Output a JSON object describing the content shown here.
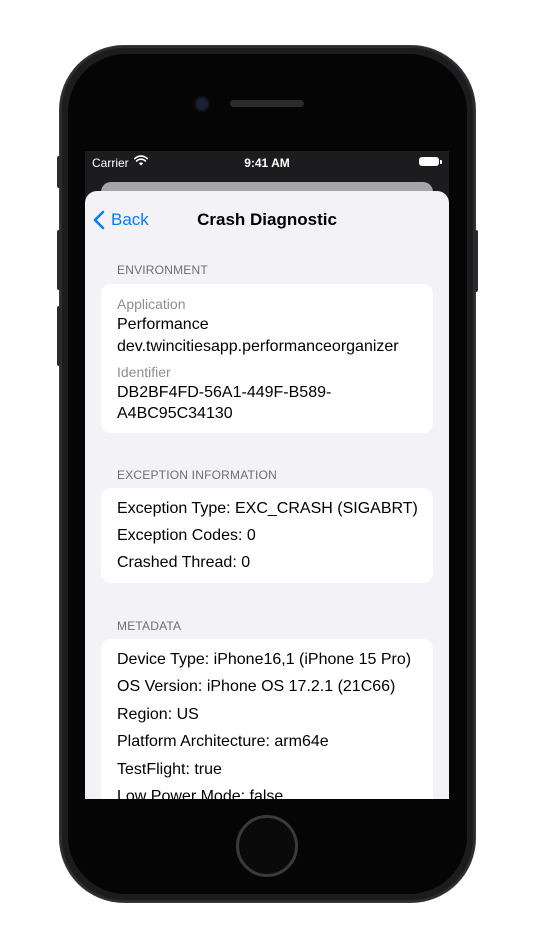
{
  "status_bar": {
    "carrier": "Carrier",
    "time": "9:41 AM"
  },
  "nav": {
    "back_label": "Back",
    "title": "Crash Diagnostic"
  },
  "environment": {
    "header": "ENVIRONMENT",
    "application_label": "Application",
    "application_name": "Performance",
    "application_bundle": "dev.twincitiesapp.performanceorganizer",
    "identifier_label": "Identifier",
    "identifier_line1": "DB2BF4FD-56A1-449F-B589-",
    "identifier_line2": "A4BC95C34130"
  },
  "exception": {
    "header": "EXCEPTION INFORMATION",
    "rows": [
      "Exception Type: EXC_CRASH (SIGABRT)",
      "Exception Codes: 0",
      "Crashed Thread: 0"
    ]
  },
  "metadata": {
    "header": "METADATA",
    "rows": [
      "Device Type: iPhone16,1 (iPhone 15 Pro)",
      "OS Version: iPhone OS 17.2.1 (21C66)",
      "Region: US",
      "Platform Architecture: arm64e",
      "TestFlight: true",
      "Low Power Mode: false"
    ]
  },
  "colors": {
    "accent": "#0a7aff",
    "background": "#f2f2f7",
    "secondary_text": "#8e8e93"
  }
}
